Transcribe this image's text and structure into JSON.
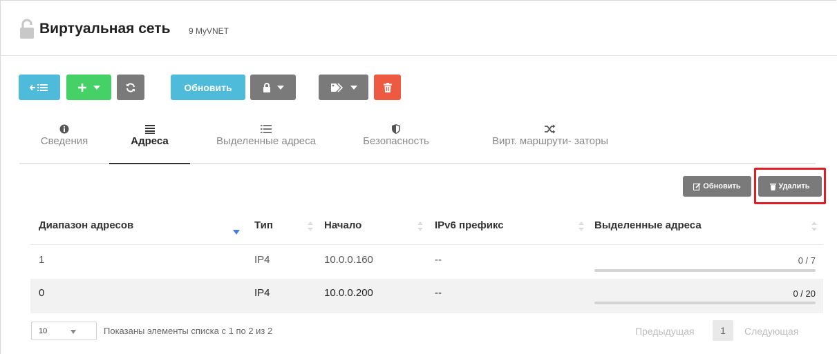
{
  "header": {
    "title": "Виртуальная сеть",
    "subtitle": "9 MyVNET",
    "icon": "lock-open-icon"
  },
  "toolbar": {
    "refresh_label": "Обновить",
    "buttons": [
      "back-list-icon",
      "add-icon",
      "reload-icon",
      "lock-icon",
      "tag-icon",
      "trash-icon"
    ]
  },
  "tabs": [
    {
      "label": "Сведения",
      "icon": "info-icon"
    },
    {
      "label": "Адреса",
      "icon": "list-icon"
    },
    {
      "label": "Выделенные адреса",
      "icon": "list-small-icon"
    },
    {
      "label": "Безопасность",
      "icon": "shield-icon"
    },
    {
      "label": "Вирт. маршрути- заторы",
      "icon": "shuffle-icon"
    }
  ],
  "actions": {
    "update_label": "Обновить",
    "delete_label": "Удалить"
  },
  "table": {
    "columns": [
      "Диапазон адресов",
      "Тип",
      "Начало",
      "IPv6 префикс",
      "Выделенные адреса"
    ],
    "rows": [
      {
        "range": "1",
        "type": "IP4",
        "start": "10.0.0.160",
        "ipv6": "--",
        "leased": "0 / 7",
        "fraction": 0
      },
      {
        "range": "0",
        "type": "IP4",
        "start": "10.0.0.200",
        "ipv6": "--",
        "leased": "0 / 20",
        "fraction": 0
      }
    ]
  },
  "footer": {
    "page_size": "10",
    "info": "Показаны элементы списка с 1 по 2 из 2",
    "prev": "Предыдущая",
    "page": "1",
    "next": "Следующая"
  },
  "colors": {
    "blue": "#4dbbd9",
    "green": "#45d166",
    "gray": "#7a7a7a",
    "red": "#ee5a41",
    "highlight": "#e01c24"
  }
}
